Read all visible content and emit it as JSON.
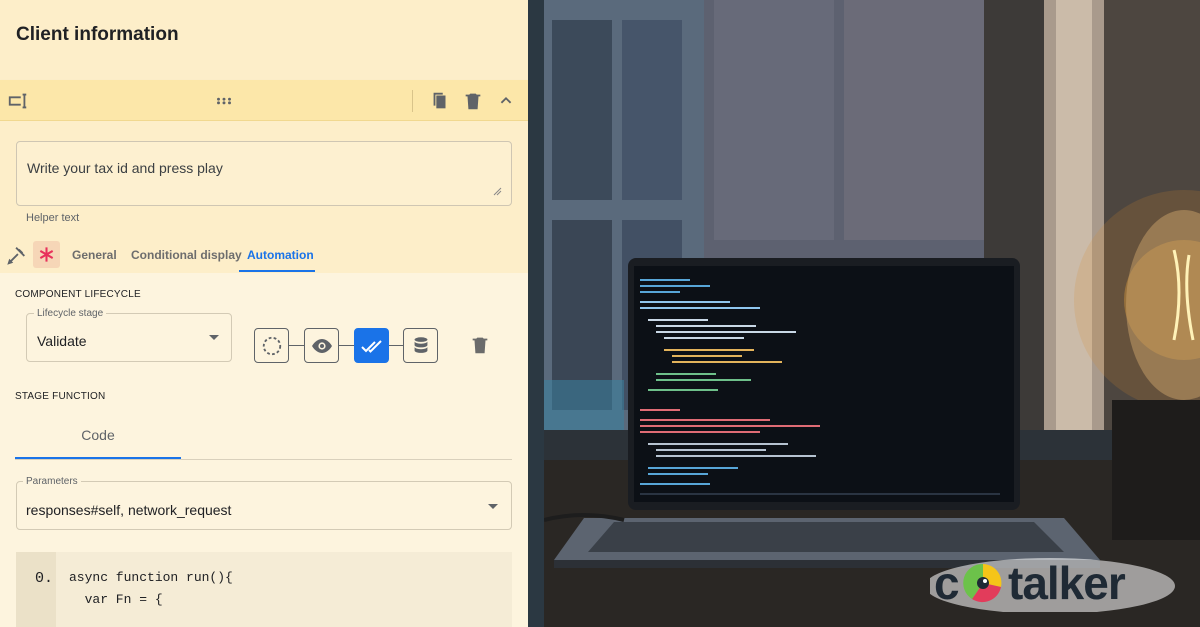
{
  "panel": {
    "title": "Client information"
  },
  "field": {
    "value": "Write your tax id and press play",
    "helper": "Helper text"
  },
  "tabs": {
    "general": "General",
    "conditional": "Conditional display",
    "automation": "Automation"
  },
  "lifecycle": {
    "section": "COMPONENT LIFECYCLE",
    "legend": "Lifecycle stage",
    "value": "Validate",
    "stages": [
      "loading-icon",
      "eye-icon",
      "double-check-icon",
      "database-icon"
    ],
    "active_stage": 2
  },
  "stage_function": {
    "section": "STAGE FUNCTION",
    "code_tab": "Code",
    "params_legend": "Parameters",
    "params_value": "responses#self, network_request"
  },
  "editor": {
    "line_number": "0.",
    "lines": [
      "async function run(){",
      "  var Fn = {"
    ]
  },
  "brand": {
    "logo_left": "c",
    "logo_right": "talker"
  },
  "colors": {
    "accent": "#1a73e8",
    "panel_bg": "#fdf4de",
    "toolbar_bg": "#fce7a9"
  }
}
